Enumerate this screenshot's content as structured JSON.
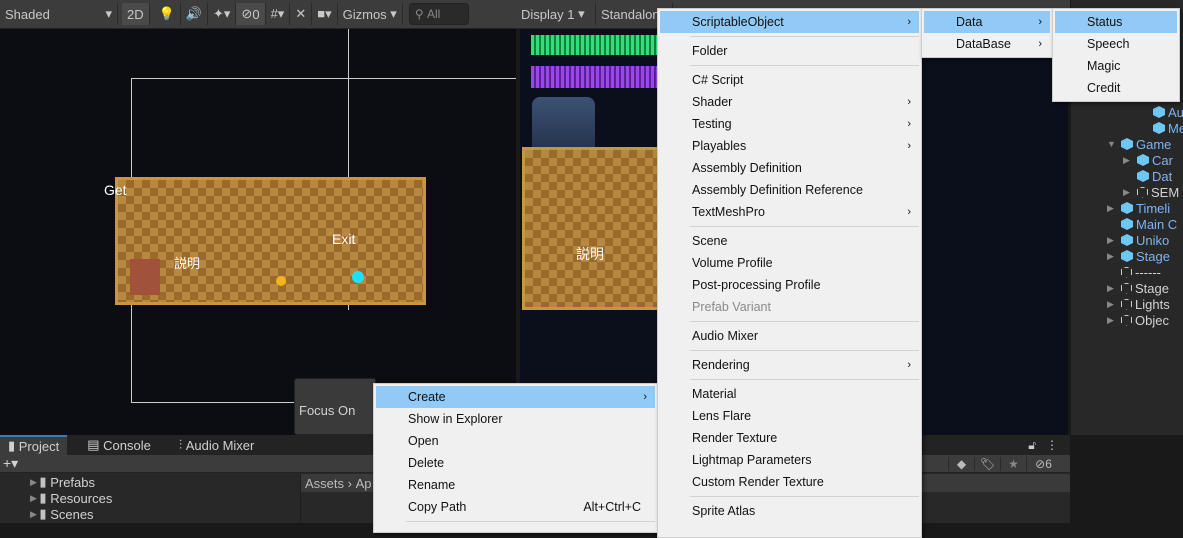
{
  "scene_toolbar": {
    "shading": "Shaded",
    "mode_2d": "2D",
    "hidden_count": "0",
    "gizmos": "Gizmos",
    "search_placeholder": "All"
  },
  "game_toolbar": {
    "display": "Display 1",
    "aspect": "Standalone"
  },
  "scene_labels": {
    "get": "Get",
    "exit": "Exit",
    "description": "説明",
    "game_description": "説明"
  },
  "focus_popup": {
    "label": "Focus On"
  },
  "hierarchy": [
    {
      "label": "Aud",
      "type": "prefab",
      "indent": 2,
      "arrow": ""
    },
    {
      "label": "Me",
      "type": "prefab-variant",
      "indent": 2,
      "arrow": ""
    },
    {
      "label": "Game",
      "type": "prefab",
      "indent": 0,
      "arrow": "open"
    },
    {
      "label": "Car",
      "type": "prefab",
      "indent": 1,
      "arrow": "closed"
    },
    {
      "label": "Dat",
      "type": "prefab",
      "indent": 1,
      "arrow": ""
    },
    {
      "label": "SEM",
      "type": "object",
      "indent": 1,
      "arrow": "closed"
    },
    {
      "label": "Timeli",
      "type": "prefab",
      "indent": 0,
      "arrow": "closed"
    },
    {
      "label": "Main C",
      "type": "prefab",
      "indent": 0,
      "arrow": ""
    },
    {
      "label": "Uniko",
      "type": "prefab",
      "indent": 0,
      "arrow": "closed"
    },
    {
      "label": "Stage",
      "type": "prefab",
      "indent": 0,
      "arrow": "closed"
    },
    {
      "label": "------",
      "type": "object",
      "indent": 0,
      "arrow": ""
    },
    {
      "label": "Stage",
      "type": "object",
      "indent": 0,
      "arrow": "closed"
    },
    {
      "label": "Lights",
      "type": "object",
      "indent": 0,
      "arrow": "closed"
    },
    {
      "label": "Objec",
      "type": "object",
      "indent": 0,
      "arrow": "closed"
    }
  ],
  "bottom": {
    "tabs": [
      "Project",
      "Console",
      "Audio Mixer"
    ],
    "add": "+▾",
    "folders": [
      "Prefabs",
      "Resources",
      "Scenes"
    ],
    "breadcrumb": [
      "Assets",
      "Ap"
    ],
    "hidden_count": "6"
  },
  "menu_context": [
    {
      "label": "Create",
      "arrow": true,
      "hl": true
    },
    {
      "label": "Show in Explorer"
    },
    {
      "label": "Open"
    },
    {
      "label": "Delete"
    },
    {
      "label": "Rename"
    },
    {
      "label": "Copy Path",
      "shortcut": "Alt+Ctrl+C"
    },
    {
      "sep": true
    }
  ],
  "menu_create": [
    {
      "label": "ScriptableObject",
      "arrow": true,
      "hl": true
    },
    {
      "sep": true
    },
    {
      "label": "Folder"
    },
    {
      "sep": true
    },
    {
      "label": "C# Script"
    },
    {
      "label": "Shader",
      "arrow": true
    },
    {
      "label": "Testing",
      "arrow": true
    },
    {
      "label": "Playables",
      "arrow": true
    },
    {
      "label": "Assembly Definition"
    },
    {
      "label": "Assembly Definition Reference"
    },
    {
      "label": "TextMeshPro",
      "arrow": true
    },
    {
      "sep": true
    },
    {
      "label": "Scene"
    },
    {
      "label": "Volume Profile"
    },
    {
      "label": "Post-processing Profile"
    },
    {
      "label": "Prefab Variant",
      "disabled": true
    },
    {
      "sep": true
    },
    {
      "label": "Audio Mixer"
    },
    {
      "sep": true
    },
    {
      "label": "Rendering",
      "arrow": true
    },
    {
      "sep": true
    },
    {
      "label": "Material"
    },
    {
      "label": "Lens Flare"
    },
    {
      "label": "Render Texture"
    },
    {
      "label": "Lightmap Parameters"
    },
    {
      "label": "Custom Render Texture"
    },
    {
      "sep": true
    },
    {
      "label": "Sprite Atlas"
    }
  ],
  "menu_scriptable": [
    {
      "label": "Data",
      "arrow": true,
      "hl": true
    },
    {
      "label": "DataBase",
      "arrow": true
    }
  ],
  "menu_data": [
    {
      "label": "Status",
      "hl": true
    },
    {
      "label": "Speech"
    },
    {
      "label": "Magic"
    },
    {
      "label": "Credit"
    }
  ],
  "colors": {
    "highlight": "#91c9f7",
    "prefab_text": "#7cb4f5"
  }
}
